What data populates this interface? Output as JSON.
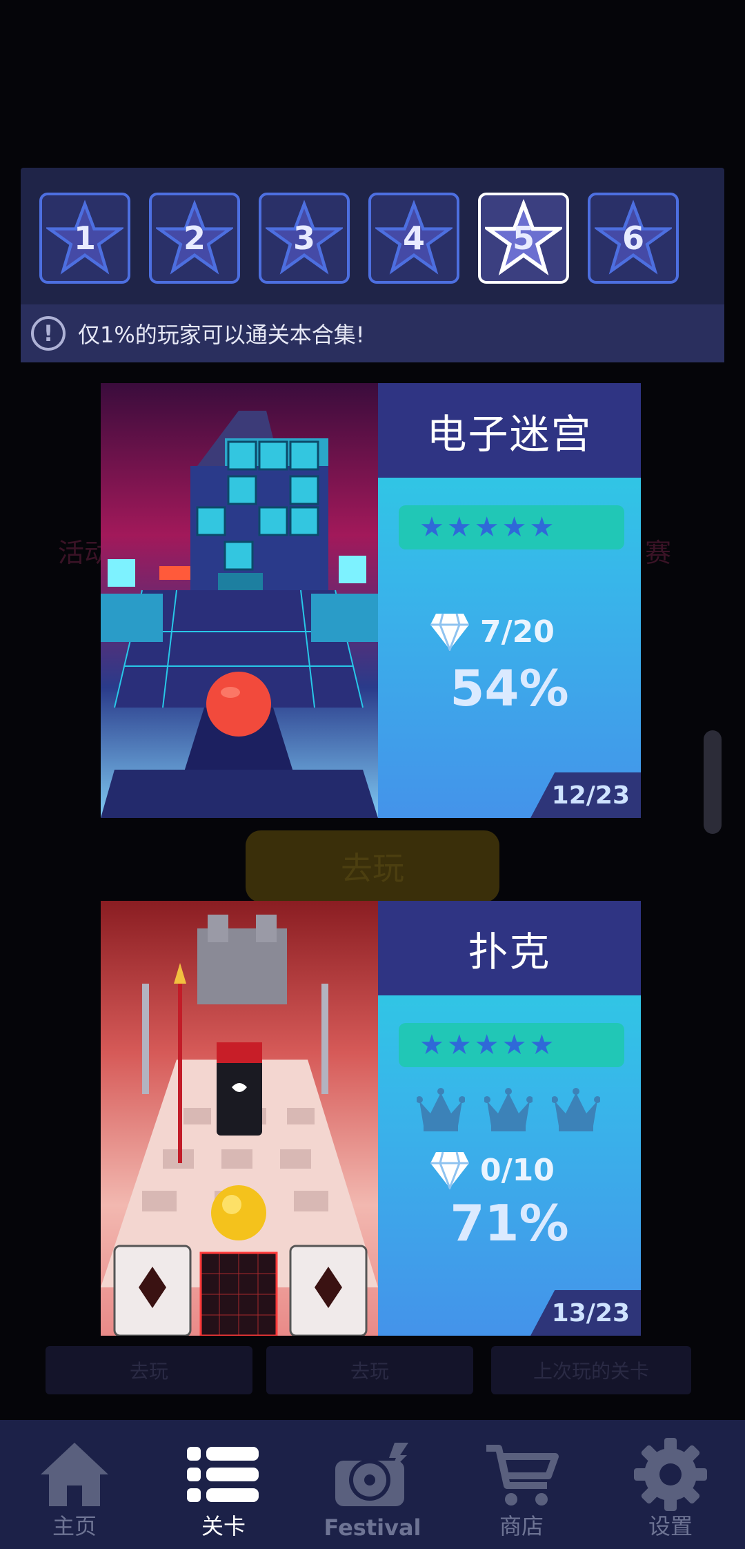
{
  "stage_selector": {
    "stages": [
      {
        "num": "1"
      },
      {
        "num": "2"
      },
      {
        "num": "3"
      },
      {
        "num": "4"
      },
      {
        "num": "5"
      },
      {
        "num": "6"
      }
    ],
    "notice_icon": "exclamation-icon",
    "notice_text": "仅1%的玩家可以通关本合集!"
  },
  "background": {
    "left_label": "活动",
    "right_label": "赛",
    "play_button": "去玩",
    "tabs": [
      "去玩",
      "去玩",
      "上次玩的关卡"
    ]
  },
  "levels": [
    {
      "title": "电子迷宫",
      "stars": 5,
      "crowns": 0,
      "gems": "7/20",
      "progress": "54%",
      "index": "12/23"
    },
    {
      "title": "扑克",
      "stars": 5,
      "crowns": 3,
      "gems": "0/10",
      "progress": "71%",
      "index": "13/23"
    }
  ],
  "nav": {
    "items": [
      {
        "label": "主页",
        "icon": "home-icon"
      },
      {
        "label": "关卡",
        "icon": "list-icon"
      },
      {
        "label": "Festival",
        "icon": "record-icon"
      },
      {
        "label": "商店",
        "icon": "cart-icon"
      },
      {
        "label": "设置",
        "icon": "gear-icon"
      }
    ],
    "active": "关卡"
  },
  "colors": {
    "panel": "#1f2448",
    "tile_border": "#4d6fe0",
    "card_title_bar": "#2f3483",
    "star_bar": "#21c7b6",
    "nav_bg": "#1c2148"
  }
}
